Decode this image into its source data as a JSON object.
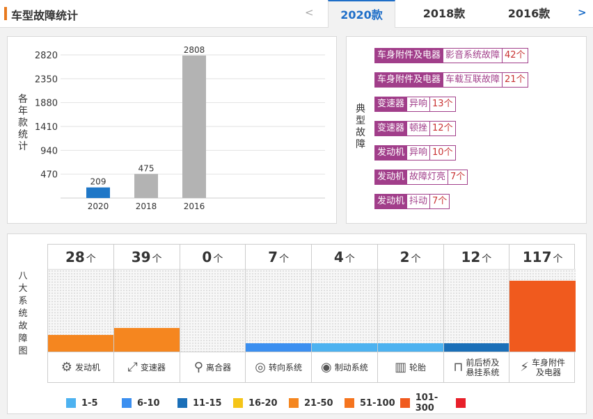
{
  "header": {
    "title": "车型故障统计",
    "prev_arrow": "<",
    "next_arrow": ">",
    "tabs": [
      "2020款",
      "2018款",
      "2016款"
    ]
  },
  "year_chart": {
    "side_label": "各年款统计"
  },
  "chart_data": {
    "type": "bar",
    "categories": [
      "2020",
      "2018",
      "2016"
    ],
    "values": [
      209,
      475,
      2808
    ],
    "ylim": [
      0,
      2820
    ],
    "yticks": [
      470,
      940,
      1410,
      1880,
      2350,
      2820
    ],
    "colors": [
      "#1f77c7",
      "#b3b3b3",
      "#b3b3b3"
    ]
  },
  "typical_faults": {
    "side_label": "典型故障",
    "items": [
      {
        "category": "车身附件及电器",
        "name": "影音系统故障",
        "count": "42个"
      },
      {
        "category": "车身附件及电器",
        "name": "车载互联故障",
        "count": "21个"
      },
      {
        "category": "变速器",
        "name": "异响",
        "count": "13个"
      },
      {
        "category": "变速器",
        "name": "顿挫",
        "count": "12个"
      },
      {
        "category": "发动机",
        "name": "异响",
        "count": "10个"
      },
      {
        "category": "发动机",
        "name": "故障灯亮",
        "count": "7个"
      },
      {
        "category": "发动机",
        "name": "抖动",
        "count": "7个"
      }
    ]
  },
  "systems": {
    "side_label": "八大系统故障图",
    "unit": "个",
    "max": 117,
    "items": [
      {
        "count": "28",
        "label": "发动机",
        "icon": "engine-icon",
        "glyph": "⚙",
        "value": 28,
        "color": "#f5861f"
      },
      {
        "count": "39",
        "label": "变速器",
        "icon": "gearshift-icon",
        "glyph": "⤢",
        "value": 39,
        "color": "#f5861f"
      },
      {
        "count": "0",
        "label": "离合器",
        "icon": "clutch-icon",
        "glyph": "⚲",
        "value": 0,
        "color": "#f5861f"
      },
      {
        "count": "7",
        "label": "转向系统",
        "icon": "steering-wheel-icon",
        "glyph": "◎",
        "value": 7,
        "color": "#3b8ff0"
      },
      {
        "count": "4",
        "label": "制动系统",
        "icon": "brake-disc-icon",
        "glyph": "◉",
        "value": 4,
        "color": "#4db2f0"
      },
      {
        "count": "2",
        "label": "轮胎",
        "icon": "tire-icon",
        "glyph": "▥",
        "value": 2,
        "color": "#4db2f0"
      },
      {
        "count": "12",
        "label": "前后桥及悬挂系统",
        "label_lines": [
          "前后桥及",
          "悬挂系统"
        ],
        "icon": "axle-icon",
        "glyph": "⊓",
        "value": 12,
        "color": "#1a6fb8"
      },
      {
        "count": "117",
        "label": "车身附件及电器",
        "label_lines": [
          "车身附件",
          "及电器"
        ],
        "icon": "battery-icon",
        "glyph": "⚡",
        "value": 117,
        "color": "#f05a1e"
      }
    ]
  },
  "legend": [
    {
      "label": "1-5",
      "color": "#4db2f0"
    },
    {
      "label": "6-10",
      "color": "#3b8ff0"
    },
    {
      "label": "11-15",
      "color": "#1a6fb8"
    },
    {
      "label": "16-20",
      "color": "#f5c518"
    },
    {
      "label": "21-50",
      "color": "#f5861f"
    },
    {
      "label": "51-100",
      "color": "#f5741e"
    },
    {
      "label": "101-300",
      "color": "#f05a1e"
    },
    {
      "label": "",
      "color": "#e8202a"
    }
  ]
}
